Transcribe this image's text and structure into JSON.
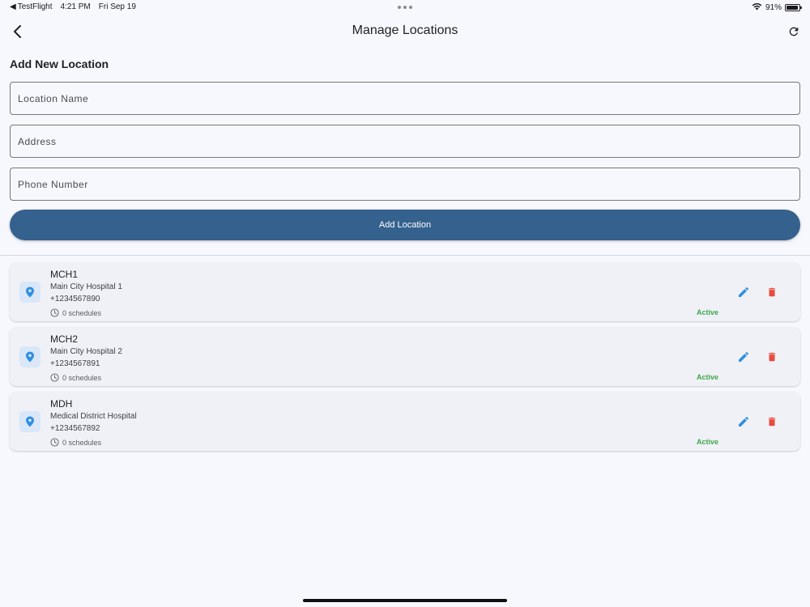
{
  "status_bar": {
    "back_app": "TestFlight",
    "time": "4:21 PM",
    "date": "Fri Sep 19",
    "battery": "91%",
    "battery_level": 0.91
  },
  "header": {
    "title": "Manage Locations",
    "back_icon": "chevron-left-icon",
    "refresh_icon": "refresh-icon"
  },
  "form": {
    "section_title": "Add New Location",
    "location_name": {
      "placeholder": "Location Name",
      "value": ""
    },
    "address": {
      "placeholder": "Address",
      "value": ""
    },
    "phone": {
      "placeholder": "Phone Number",
      "value": ""
    },
    "submit_label": "Add Location"
  },
  "locations": [
    {
      "name": "MCH1",
      "address": "Main City Hospital 1",
      "phone": "+1234567890",
      "schedules": "0 schedules",
      "status": "Active"
    },
    {
      "name": "MCH2",
      "address": "Main City Hospital 2",
      "phone": "+1234567891",
      "schedules": "0 schedules",
      "status": "Active"
    },
    {
      "name": "MDH",
      "address": "Medical District Hospital",
      "phone": "+1234567892",
      "schedules": "0 schedules",
      "status": "Active"
    }
  ],
  "colors": {
    "primary": "#35618f",
    "icon_blue": "#2f8fe0",
    "delete_red": "#e84c3d",
    "active_green": "#3da74a",
    "background": "#f7f8fd"
  }
}
